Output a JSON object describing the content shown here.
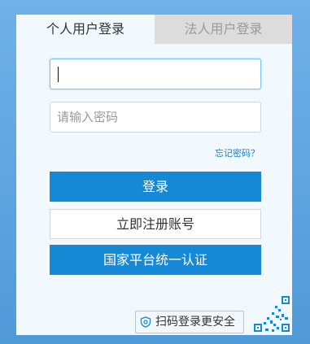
{
  "tabs": {
    "personal": "个人用户登录",
    "legal": "法人用户登录"
  },
  "form": {
    "username_value": "",
    "password_placeholder": "请输入密码",
    "forgot_password": "忘记密码？"
  },
  "buttons": {
    "login": "登录",
    "register": "立即注册账号",
    "unified_auth": "国家平台统一认证"
  },
  "qr": {
    "tip": "扫码登录更安全"
  },
  "colors": {
    "primary": "#1589d5",
    "background": "#5aa3e2",
    "panel": "#f1f8fe",
    "inactive_tab": "#dcdcdc",
    "link": "#1f7fc4"
  }
}
